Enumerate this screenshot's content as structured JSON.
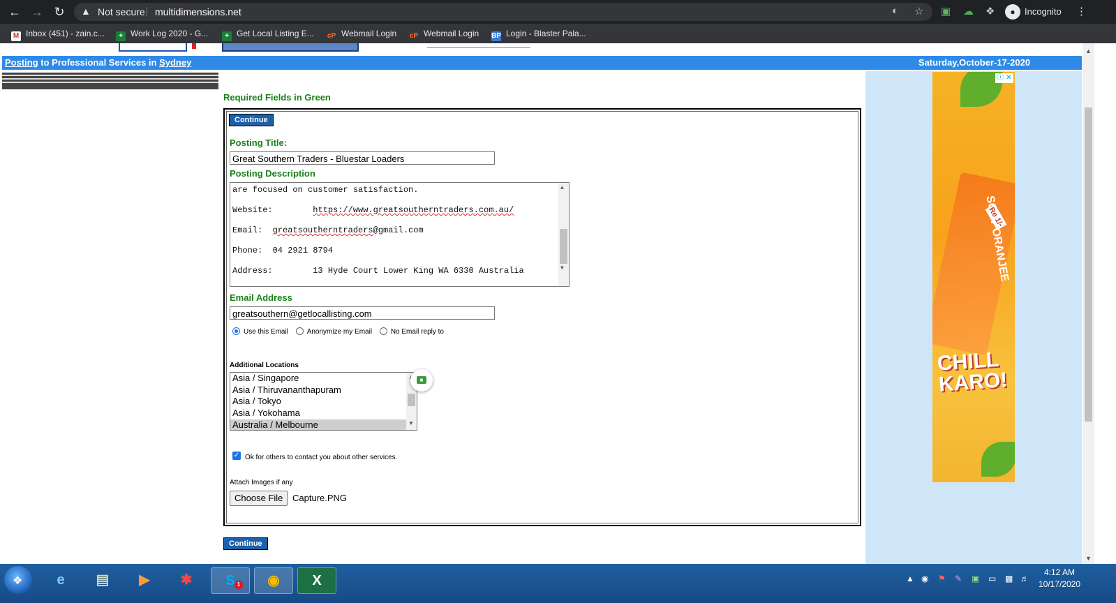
{
  "browser": {
    "security_label": "Not secure",
    "url": "multidimensions.net",
    "profile_label": "Incognito",
    "bookmarks": [
      {
        "label": "Inbox (451) - zain.c...",
        "icon": "gmail-icon",
        "color": "#d93025"
      },
      {
        "label": "Work Log 2020 - G...",
        "icon": "sheets-icon",
        "color": "#188038"
      },
      {
        "label": "Get Local Listing E...",
        "icon": "sheets-icon",
        "color": "#188038"
      },
      {
        "label": "Webmail Login",
        "icon": "cpanel-icon",
        "color": "#ff6c2c"
      },
      {
        "label": "Webmail Login",
        "icon": "cpanel-icon",
        "color": "#ff6c2c"
      },
      {
        "label": "Login - Blaster Pala...",
        "icon": "bp-icon",
        "color": "#3a7bd5"
      }
    ]
  },
  "header": {
    "breadcrumb_link": "Posting",
    "breadcrumb_rest": " to Professional Services in ",
    "breadcrumb_city": "Sydney",
    "date": "Saturday,October-17-2020"
  },
  "form": {
    "required_note": "Required Fields in Green",
    "continue_label": "Continue",
    "title_label": "Posting Title:",
    "title_value": "Great Southern Traders - Bluestar Loaders",
    "description_label": "Posting Description",
    "description_lines": [
      "are focused on customer satisfaction.",
      "",
      "Website:        https://www.greatsoutherntraders.com.au/",
      "",
      "Email:  greatsoutherntraders@gmail.com",
      "",
      "Phone:  04 2921 8794",
      "",
      "Address:        13 Hyde Court Lower King WA 6330 Australia"
    ],
    "email_label": "Email Address",
    "email_value": "greatsouthern@getlocallisting.com",
    "email_options": [
      "Use this Email",
      "Anonymize my Email",
      "No Email reply to"
    ],
    "email_option_selected": "Use this Email",
    "locations_label": "Additional Locations",
    "locations": [
      "Asia / Singapore",
      "Asia / Thiruvananthapuram",
      "Asia / Tokyo",
      "Asia / Yokohama",
      "Australia / Melbourne"
    ],
    "locations_selected": "Australia / Melbourne",
    "contact_ok_label": "Ok for others to contact you about other services.",
    "contact_ok_checked": true,
    "attach_label": "Attach Images if any",
    "choose_file_label": "Choose File",
    "file_name": "Capture.PNG"
  },
  "ad": {
    "brand_text": "SOFT ORANJEE",
    "badge_text": "Re 1/-",
    "tagline": "CHILL KARO!",
    "close_text": "ⓘ ✕"
  },
  "taskbar": {
    "time": "4:12 AM",
    "date": "10/17/2020",
    "apps": [
      "ie-icon",
      "explorer-icon",
      "media-player-icon",
      "app-icon",
      "skype-icon",
      "chrome-icon",
      "excel-icon"
    ],
    "skype_badge": "1"
  },
  "colors": {
    "accent_blue": "#2e8ae6",
    "required_green": "#1a7f1a",
    "side_panel": "#cfe6f9",
    "button_blue": "#1d5fa8"
  }
}
